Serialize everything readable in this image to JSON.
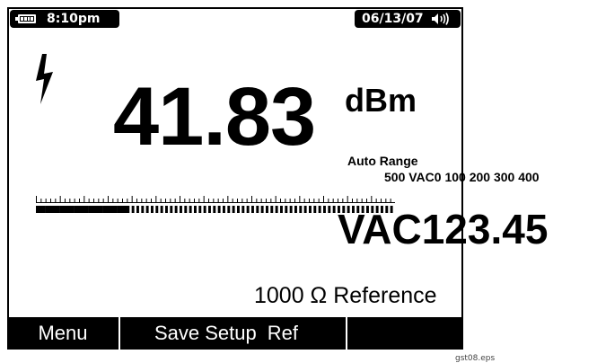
{
  "status": {
    "time": "8:10pm",
    "date": "06/13/07",
    "battery_icon": "battery-full-icon",
    "speaker_icon": "speaker-on-icon"
  },
  "warning_icon": "high-voltage-lightning-icon",
  "primary": {
    "value": "41.83",
    "unit": "dBm"
  },
  "range": {
    "label": "Auto Range",
    "scale": "500 VAC0 100 200 300 400"
  },
  "bargraph": {
    "fill_fraction": 0.25,
    "segments": 75
  },
  "secondary": {
    "text": "VAC123.45"
  },
  "reference": {
    "text": "1000 Ω Reference"
  },
  "softkeys": [
    "Menu",
    "Save Setup",
    "Ref",
    ""
  ],
  "caption": "gst08.eps"
}
